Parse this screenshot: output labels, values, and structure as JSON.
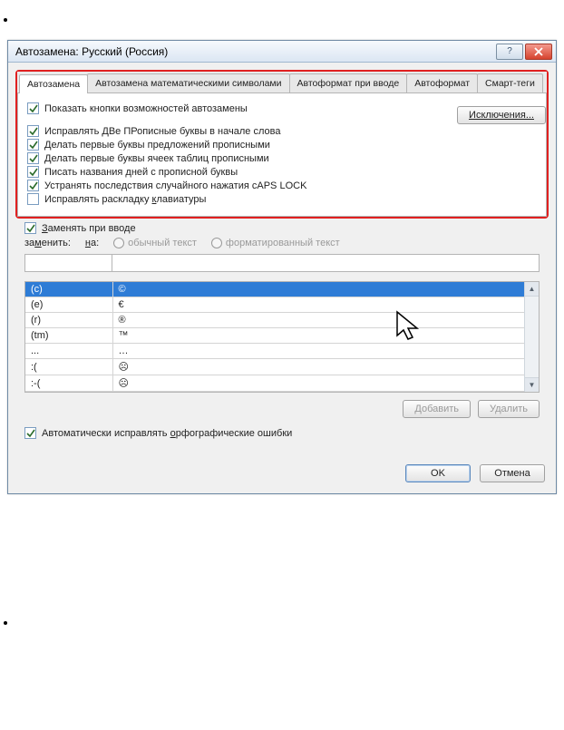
{
  "window": {
    "title": "Автозамена: Русский (Россия)"
  },
  "tabs": {
    "t0": "Автозамена",
    "t1": "Автозамена математическими символами",
    "t2": "Автоформат при вводе",
    "t3": "Автоформат",
    "t4": "Смарт-теги"
  },
  "options": {
    "show_buttons": "Показать кнопки возможностей автозамены",
    "fix_two_caps": "Исправлять ДВе ПРописные буквы в начале слова",
    "cap_sentences": "Делать первые буквы предложений прописными",
    "cap_cells": "Делать первые буквы ячеек таблиц прописными",
    "cap_days": "Писать названия дней с прописной буквы",
    "caps_lock": "Устранять последствия случайного нажатия cAPS LOCK",
    "keyboard_layout": "Исправлять раскладку клавиатуры",
    "replace_on_type": "Заменять при вводе",
    "auto_spell": "Автоматически исправлять орфографические ошибки",
    "exceptions_btn": "Исключения..."
  },
  "replace": {
    "label_replace": "заменить:",
    "label_with": "на:",
    "radio_plain": "обычный текст",
    "radio_formatted": "форматированный текст"
  },
  "list": {
    "rows": [
      {
        "from": "(c)",
        "to": "©"
      },
      {
        "from": "(e)",
        "to": "€"
      },
      {
        "from": "(r)",
        "to": "®"
      },
      {
        "from": "(tm)",
        "to": "™"
      },
      {
        "from": "...",
        "to": "…"
      },
      {
        "from": ":(",
        "to": "☹"
      },
      {
        "from": ":-(",
        "to": "☹"
      }
    ]
  },
  "buttons": {
    "add": "Добавить",
    "delete": "Удалить",
    "ok": "OK",
    "cancel": "Отмена"
  }
}
